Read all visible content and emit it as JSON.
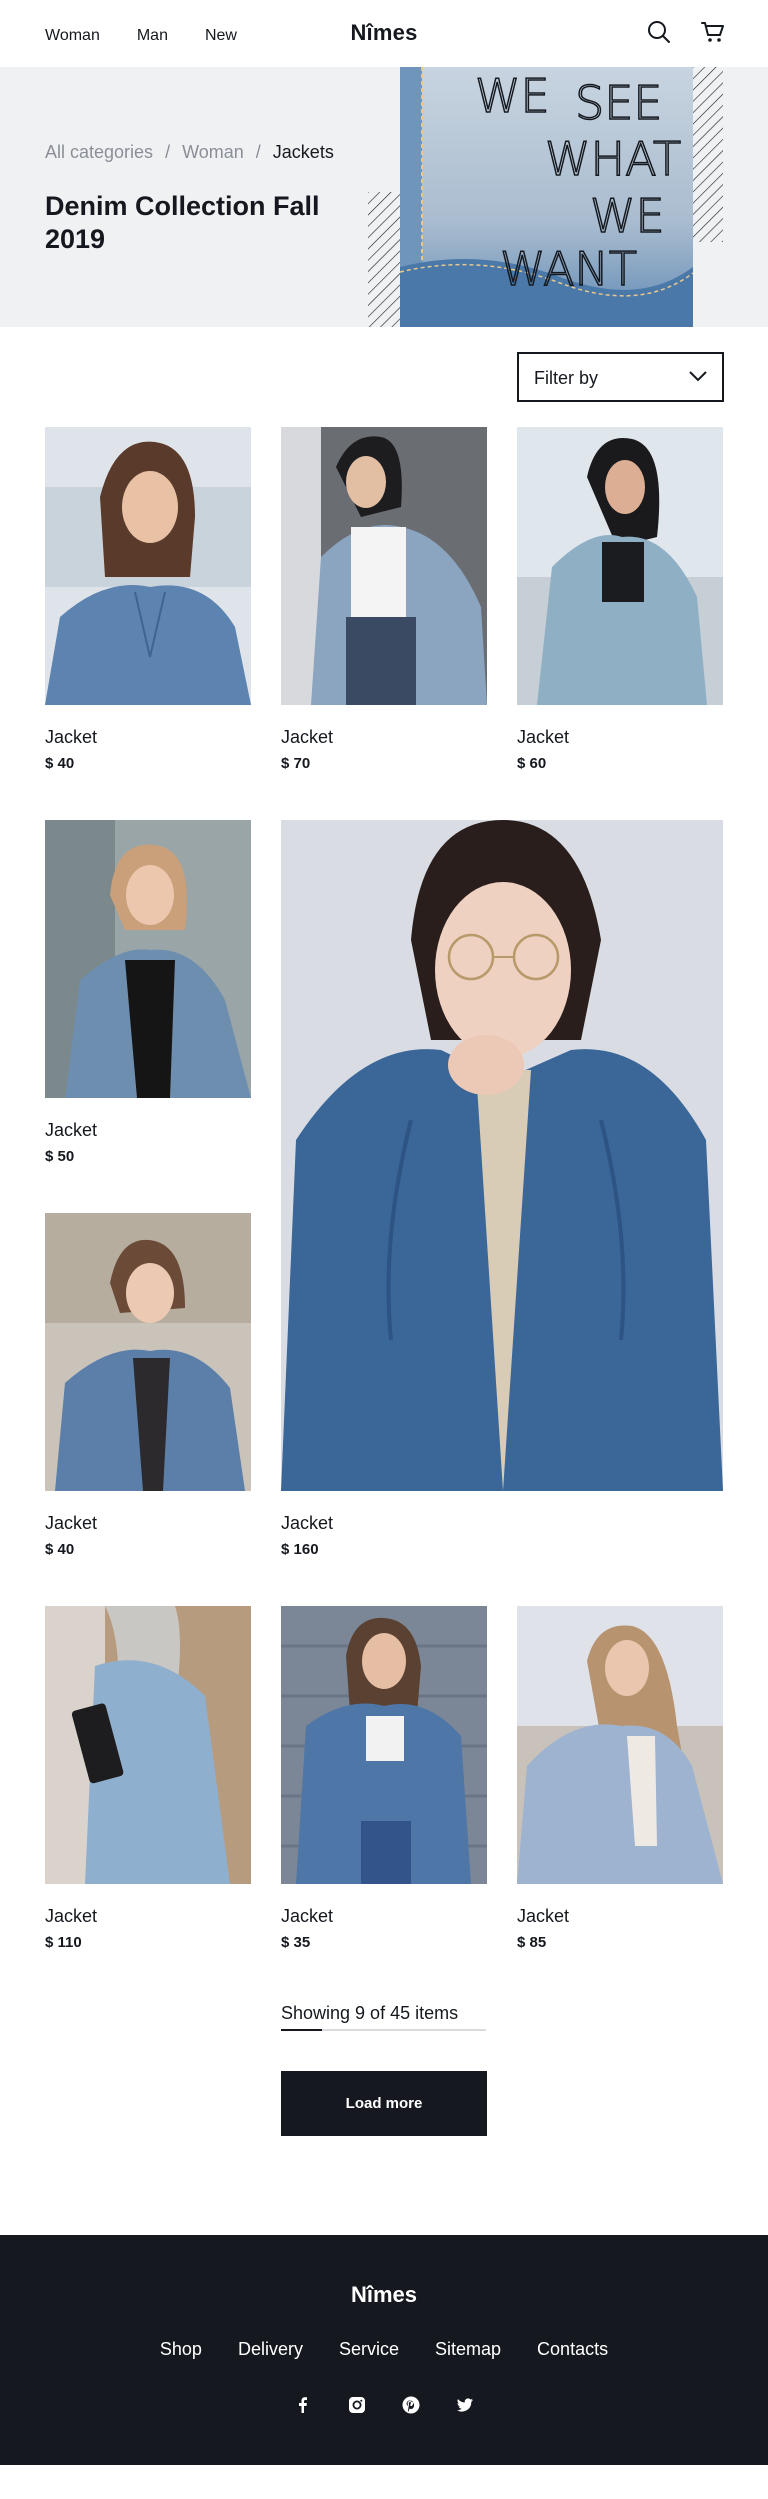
{
  "header": {
    "nav": [
      "Woman",
      "Man",
      "New"
    ],
    "logo": "Nîmes",
    "icons": [
      "search-icon",
      "cart-icon"
    ]
  },
  "hero": {
    "breadcrumb": [
      "All categories",
      "Woman",
      "Jackets"
    ],
    "separator": "/",
    "title": "Denim Collection Fall 2019",
    "image_text": "WE SEE WHAT WE WANT"
  },
  "filter": {
    "label": "Filter by"
  },
  "products": [
    {
      "name": "Jacket",
      "price": "$ 40"
    },
    {
      "name": "Jacket",
      "price": "$ 70"
    },
    {
      "name": "Jacket",
      "price": "$ 60"
    },
    {
      "name": "Jacket",
      "price": "$ 50"
    },
    {
      "name": "Jacket",
      "price": "$ 160"
    },
    {
      "name": "Jacket",
      "price": "$ 40"
    },
    {
      "name": "Jacket",
      "price": "$ 110"
    },
    {
      "name": "Jacket",
      "price": "$ 35"
    },
    {
      "name": "Jacket",
      "price": "$ 85"
    }
  ],
  "pagination": {
    "showing": "Showing 9 of 45 items",
    "progress": 0.2,
    "load_more": "Load more"
  },
  "footer": {
    "logo": "Nîmes",
    "links": [
      "Shop",
      "Delivery",
      "Service",
      "Sitemap",
      "Contacts"
    ],
    "social": [
      "facebook-icon",
      "instagram-icon",
      "pinterest-icon",
      "twitter-icon"
    ]
  },
  "colors": {
    "dark": "#15191f",
    "hero_bg": "#f0f1f3",
    "denim": "#4f79a8"
  }
}
